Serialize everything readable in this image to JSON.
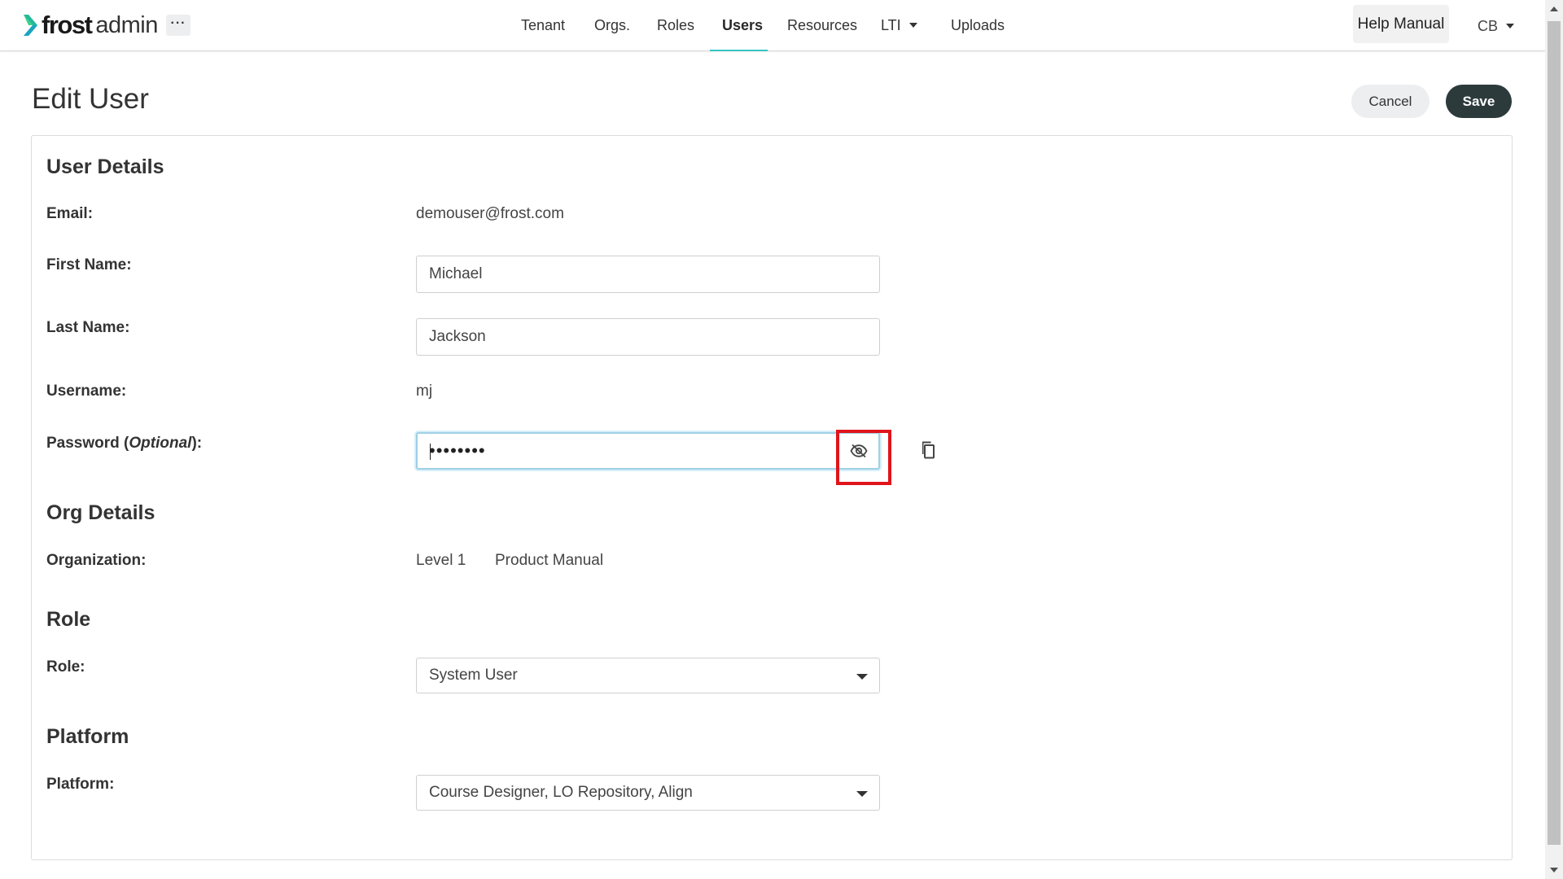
{
  "app": {
    "brand_strong": "frost",
    "brand_light": "admin",
    "more_label": "···"
  },
  "nav": {
    "items": [
      {
        "label": "Tenant"
      },
      {
        "label": "Orgs."
      },
      {
        "label": "Roles"
      },
      {
        "label": "Users",
        "active": true
      },
      {
        "label": "Resources"
      },
      {
        "label": "LTI",
        "has_dropdown": true
      },
      {
        "label": "Uploads"
      }
    ],
    "help_label": "Help Manual",
    "user_initials": "CB"
  },
  "page": {
    "title": "Edit User",
    "cancel_label": "Cancel",
    "save_label": "Save"
  },
  "user_details": {
    "section_title": "User Details",
    "email_label": "Email:",
    "email_value": "demouser@frost.com",
    "first_name_label": "First Name:",
    "first_name_value": "Michael",
    "last_name_label": "Last Name:",
    "last_name_value": "Jackson",
    "username_label": "Username:",
    "username_value": "mj",
    "password_label_prefix": "Password (",
    "password_label_optional": "Optional",
    "password_label_suffix": "):",
    "password_masked": "••••••••"
  },
  "org_details": {
    "section_title": "Org Details",
    "organization_label": "Organization:",
    "level": "Level 1",
    "org_name": "Product Manual"
  },
  "role": {
    "section_title": "Role",
    "role_label": "Role:",
    "role_value": "System User"
  },
  "platform": {
    "section_title": "Platform",
    "platform_label": "Platform:",
    "platform_value": "Course Designer, LO Repository, Align"
  },
  "icons": {
    "toggle_password": "eye-off-icon",
    "copy_password": "copy-icon",
    "highlight_color": "#e0141b"
  },
  "colors": {
    "accent": "#37c4c4",
    "primary_button": "#2c3a3b",
    "logo_chevron_top": "#2bd18c",
    "logo_chevron_bottom": "#1a9fc4"
  }
}
